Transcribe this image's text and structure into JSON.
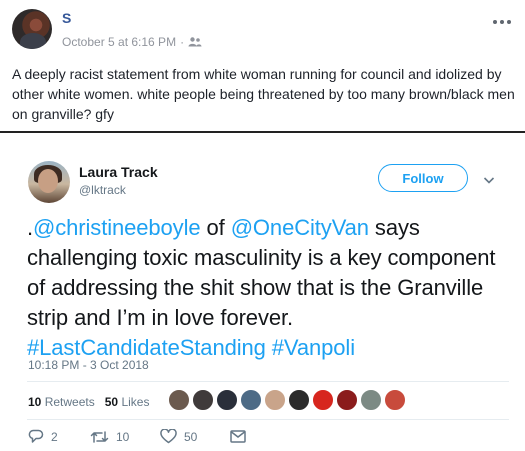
{
  "post": {
    "author": "S",
    "date": "October 5 at 6:16 PM",
    "meta_sep": "·",
    "privacy_icon": "friends-icon",
    "more_icon": "more-icon",
    "text": "A deeply racist statement from white woman running for council and idolized by other white women. white people being threatened by too many brown/black men on granville? gfy"
  },
  "tweet": {
    "name": "Laura Track",
    "handle": "@lktrack",
    "follow_label": "Follow",
    "text_parts": {
      "p1": ".",
      "mention1": "@christineeboyle",
      "p2": " of ",
      "mention2": "@OneCityVan",
      "p3": " says challenging toxic masculinity is a key component of addressing the shit show that is the Granville strip and I’m in love forever. ",
      "hashtag1": "#LastCandidateStanding",
      "p4": " ",
      "hashtag2": "#Vanpoli"
    },
    "timestamp": "10:18 PM - 3 Oct 2018",
    "retweets_count": "10",
    "retweets_label": "Retweets",
    "likes_count": "50",
    "likes_label": "Likes",
    "actions": {
      "reply_count": "2",
      "retweet_count": "10",
      "like_count": "50"
    }
  },
  "colors": {
    "fb_link": "#365899",
    "twitter_blue": "#1da1f2",
    "muted": "#657786",
    "liker_avatars": [
      "#6b5a4e",
      "#3f3a3a",
      "#2a2f3a",
      "#4d6b86",
      "#c9a48a",
      "#2b2b2b",
      "#d7261e",
      "#8b1c1c",
      "#7c8a84",
      "#c84b3c"
    ]
  }
}
